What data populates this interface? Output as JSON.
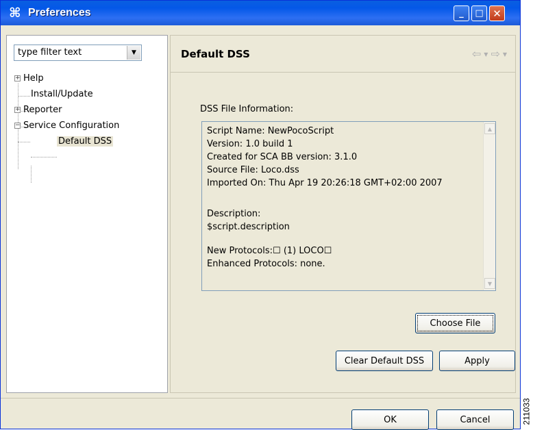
{
  "window": {
    "title": "Preferences",
    "icon": "cisco-command-icon",
    "icon_glyph": "⌘",
    "controls": {
      "minimize": "_",
      "maximize": "□",
      "close": "✕"
    }
  },
  "left_pane": {
    "filter": {
      "value": "type filter text",
      "arrow": "▼"
    },
    "tree": [
      {
        "label": "Help",
        "expander": "+",
        "selected": false
      },
      {
        "label": "Install/Update",
        "expander": "",
        "selected": false
      },
      {
        "label": "Reporter",
        "expander": "+",
        "selected": false
      },
      {
        "label": "Service Configuration",
        "expander": "−",
        "selected": false
      },
      {
        "label": "Default DSS",
        "expander": "",
        "selected": true
      }
    ]
  },
  "right_pane": {
    "title": "Default DSS",
    "nav": {
      "back": "⇦",
      "back_menu": "▼",
      "forward": "⇨",
      "forward_menu": "▼"
    },
    "info_label": "DSS File Information:",
    "info_lines": [
      "Script Name: NewPocoScript",
      "Version: 1.0 build 1",
      "Created for SCA BB version: 3.1.0",
      "Source File: Loco.dss",
      "Imported On: Thu Apr 19 20:26:18 GMT+02:00 2007",
      "",
      "Description:",
      "$script.description",
      "",
      "New Protocols:☐ (1) LOCO☐",
      "Enhanced Protocols: none."
    ],
    "scroll": {
      "up": "▲",
      "down": "▼"
    },
    "buttons": {
      "choose_file": "Choose File",
      "clear_default": "Clear Default DSS",
      "apply": "Apply"
    }
  },
  "footer": {
    "ok": "OK",
    "cancel": "Cancel"
  },
  "stamp": "211033"
}
